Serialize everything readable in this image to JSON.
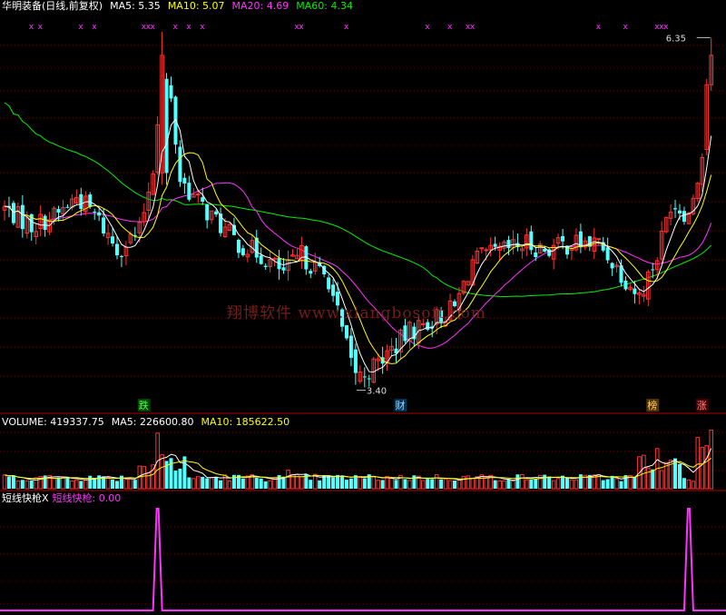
{
  "header_main": {
    "title": "华明装备(日线,前复权)",
    "ma5": "MA5: 5.35",
    "ma10": "MA10: 5.07",
    "ma20": "MA20: 4.69",
    "ma60": "MA60: 4.34"
  },
  "header_volume": {
    "title": "VOLUME: 419337.75",
    "ma5": "MA5: 226600.80",
    "ma10": "MA10: 185622.50"
  },
  "header_indicator": {
    "title": "短线快枪X",
    "value_label": "短线快枪: 0.00"
  },
  "watermark": "翔博软件 www.xiangbosoft.com",
  "colors": {
    "up": "#ff3333",
    "down": "#54ffff",
    "ma5": "#ffffff",
    "ma10": "#ffff00",
    "ma20": "#ff33ff",
    "ma60": "#00ee00",
    "grid": "#7a0000",
    "signal": "#ff33ff"
  },
  "chart_data": [
    {
      "type": "candlestick",
      "title": "华明装备(日线,前复权)",
      "annotations": {
        "high": "6.35",
        "low": "3.40"
      },
      "event_tags": [
        "跌",
        "财",
        "榜",
        "涨"
      ],
      "marker_symbol": "x",
      "marker_count": 22
    },
    {
      "type": "bar",
      "title": "VOLUME",
      "last_value": 419337.75,
      "ma5": 226600.8,
      "ma10": 185622.5
    },
    {
      "type": "line",
      "title": "短线快枪X",
      "series_label": "短线快枪",
      "last_value": 0.0,
      "peaks": 2
    }
  ]
}
